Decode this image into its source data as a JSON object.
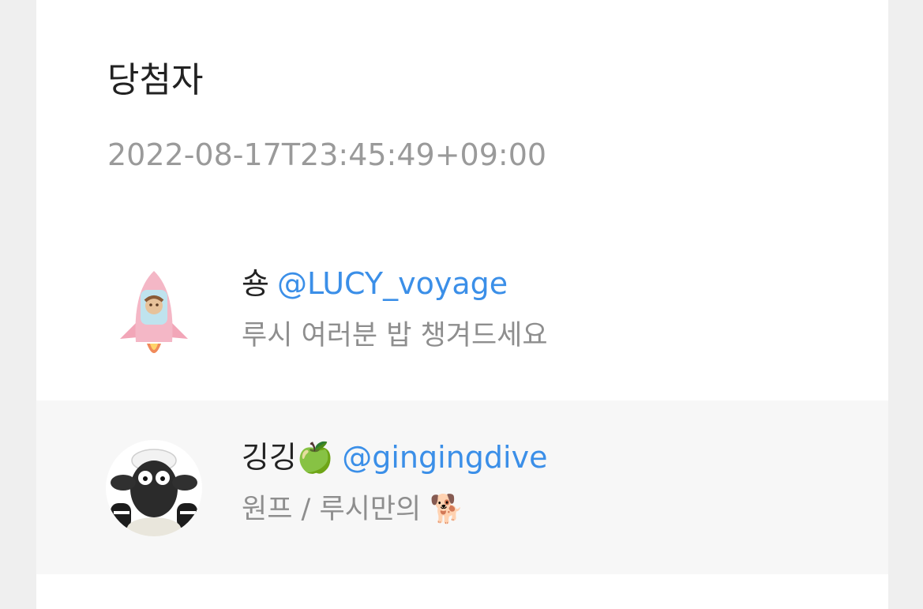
{
  "header": {
    "title": "당첨자",
    "timestamp": "2022-08-17T23:45:49+09:00"
  },
  "winners": [
    {
      "name": "숑",
      "handle": "@LUCY_voyage",
      "message": "루시 여러분 밥 챙겨드세요",
      "avatar_icon": "rocket-icon"
    },
    {
      "name": "깅깅🍏",
      "handle": "@gingingdive",
      "message": "원프 / 루시만의 🐕",
      "avatar_icon": "sheep-icon"
    }
  ],
  "colors": {
    "handle": "#3b8fe8",
    "timestamp": "#9a9a9a",
    "message": "#8e8e8e",
    "highlight_row": "#f7f7f7",
    "page_background": "#efefef"
  }
}
